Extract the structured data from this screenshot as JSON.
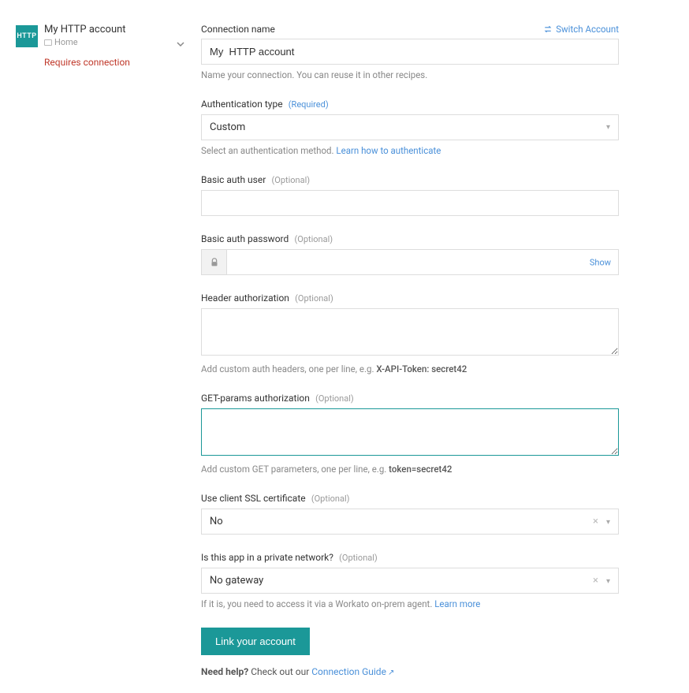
{
  "sidebar": {
    "badge_text": "HTTP",
    "account_title": "My HTTP account",
    "folder_path": "Home",
    "status_text": "Requires connection"
  },
  "header": {
    "switch_account_label": "Switch Account"
  },
  "fields": {
    "connection_name": {
      "label": "Connection name",
      "value": "My  HTTP account",
      "help": "Name your connection. You can reuse it in other recipes."
    },
    "auth_type": {
      "label": "Authentication type",
      "tag": "(Required)",
      "value": "Custom",
      "help_prefix": "Select an authentication method. ",
      "help_link": "Learn how to authenticate"
    },
    "basic_user": {
      "label": "Basic auth user",
      "tag": "(Optional)",
      "value": ""
    },
    "basic_password": {
      "label": "Basic auth password",
      "tag": "(Optional)",
      "value": "",
      "show_label": "Show"
    },
    "header_auth": {
      "label": "Header authorization",
      "tag": "(Optional)",
      "value": "",
      "help_prefix": "Add custom auth headers, one per line, e.g. ",
      "help_example": "X-API-Token: secret42"
    },
    "get_params": {
      "label": "GET-params authorization",
      "tag": "(Optional)",
      "value": "",
      "help_prefix": "Add custom GET parameters, one per line, e.g. ",
      "help_example": "token=secret42"
    },
    "ssl_cert": {
      "label": "Use client SSL certificate",
      "tag": "(Optional)",
      "value": "No"
    },
    "private_network": {
      "label": "Is this app in a private network?",
      "tag": "(Optional)",
      "value": "No gateway",
      "help_prefix": "If it is, you need to access it via a Workato on-prem agent. ",
      "help_link": "Learn more"
    }
  },
  "actions": {
    "link_button": "Link your account",
    "need_help_prefix": "Need help? ",
    "need_help_text": "Check out our ",
    "connection_guide": "Connection Guide"
  }
}
